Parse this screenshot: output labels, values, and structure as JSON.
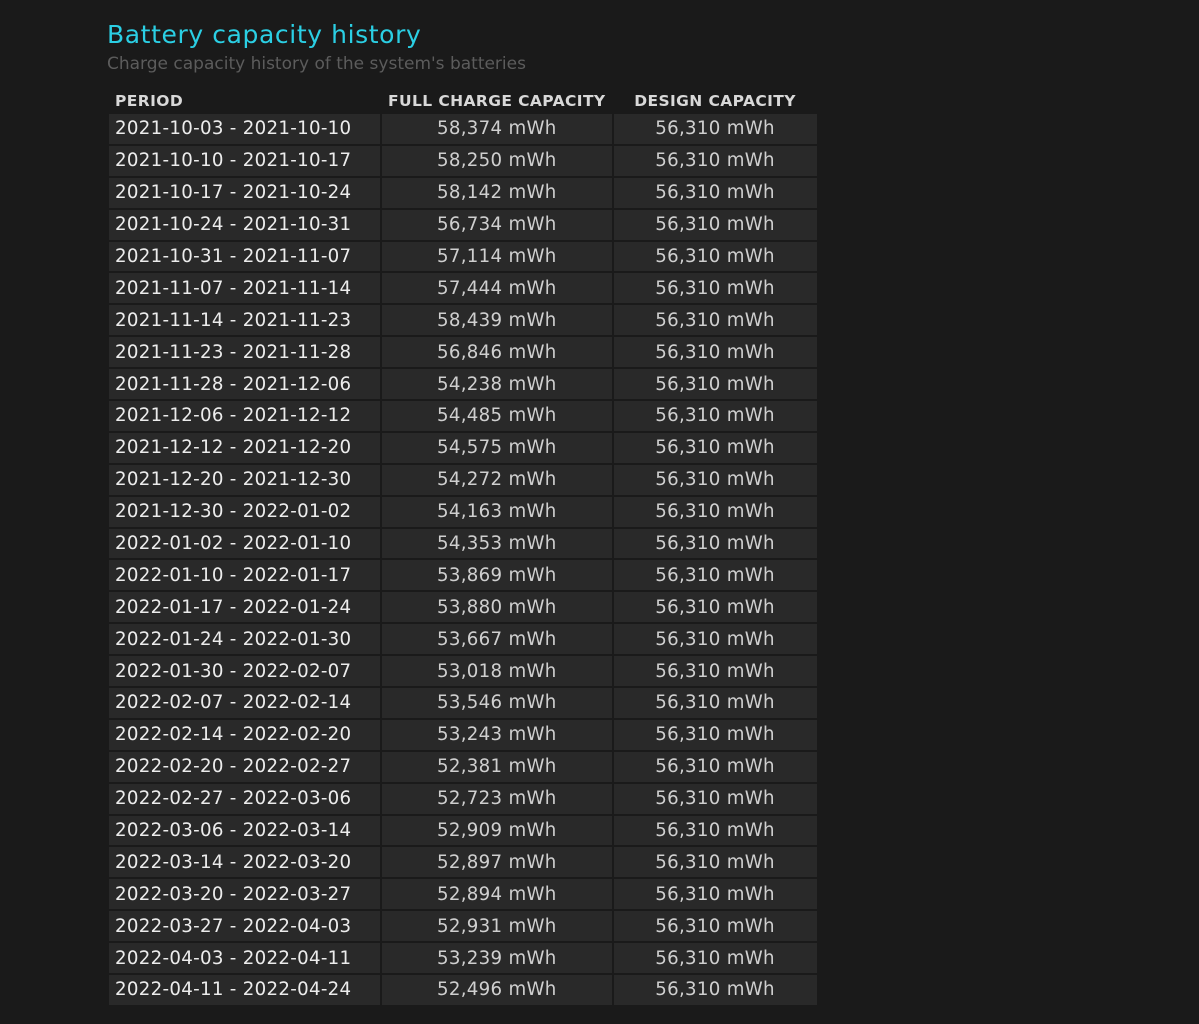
{
  "section": {
    "title": "Battery capacity history",
    "subtitle": "Charge capacity history of the system's batteries"
  },
  "table": {
    "headers": [
      "PERIOD",
      "FULL CHARGE CAPACITY",
      "DESIGN CAPACITY"
    ],
    "rows": [
      {
        "period": "2021-10-03 - 2021-10-10",
        "full": "58,374 mWh",
        "design": "56,310 mWh"
      },
      {
        "period": "2021-10-10 - 2021-10-17",
        "full": "58,250 mWh",
        "design": "56,310 mWh"
      },
      {
        "period": "2021-10-17 - 2021-10-24",
        "full": "58,142 mWh",
        "design": "56,310 mWh"
      },
      {
        "period": "2021-10-24 - 2021-10-31",
        "full": "56,734 mWh",
        "design": "56,310 mWh"
      },
      {
        "period": "2021-10-31 - 2021-11-07",
        "full": "57,114 mWh",
        "design": "56,310 mWh"
      },
      {
        "period": "2021-11-07 - 2021-11-14",
        "full": "57,444 mWh",
        "design": "56,310 mWh"
      },
      {
        "period": "2021-11-14 - 2021-11-23",
        "full": "58,439 mWh",
        "design": "56,310 mWh"
      },
      {
        "period": "2021-11-23 - 2021-11-28",
        "full": "56,846 mWh",
        "design": "56,310 mWh"
      },
      {
        "period": "2021-11-28 - 2021-12-06",
        "full": "54,238 mWh",
        "design": "56,310 mWh"
      },
      {
        "period": "2021-12-06 - 2021-12-12",
        "full": "54,485 mWh",
        "design": "56,310 mWh"
      },
      {
        "period": "2021-12-12 - 2021-12-20",
        "full": "54,575 mWh",
        "design": "56,310 mWh"
      },
      {
        "period": "2021-12-20 - 2021-12-30",
        "full": "54,272 mWh",
        "design": "56,310 mWh"
      },
      {
        "period": "2021-12-30 - 2022-01-02",
        "full": "54,163 mWh",
        "design": "56,310 mWh"
      },
      {
        "period": "2022-01-02 - 2022-01-10",
        "full": "54,353 mWh",
        "design": "56,310 mWh"
      },
      {
        "period": "2022-01-10 - 2022-01-17",
        "full": "53,869 mWh",
        "design": "56,310 mWh"
      },
      {
        "period": "2022-01-17 - 2022-01-24",
        "full": "53,880 mWh",
        "design": "56,310 mWh"
      },
      {
        "period": "2022-01-24 - 2022-01-30",
        "full": "53,667 mWh",
        "design": "56,310 mWh"
      },
      {
        "period": "2022-01-30 - 2022-02-07",
        "full": "53,018 mWh",
        "design": "56,310 mWh"
      },
      {
        "period": "2022-02-07 - 2022-02-14",
        "full": "53,546 mWh",
        "design": "56,310 mWh"
      },
      {
        "period": "2022-02-14 - 2022-02-20",
        "full": "53,243 mWh",
        "design": "56,310 mWh"
      },
      {
        "period": "2022-02-20 - 2022-02-27",
        "full": "52,381 mWh",
        "design": "56,310 mWh"
      },
      {
        "period": "2022-02-27 - 2022-03-06",
        "full": "52,723 mWh",
        "design": "56,310 mWh"
      },
      {
        "period": "2022-03-06 - 2022-03-14",
        "full": "52,909 mWh",
        "design": "56,310 mWh"
      },
      {
        "period": "2022-03-14 - 2022-03-20",
        "full": "52,897 mWh",
        "design": "56,310 mWh"
      },
      {
        "period": "2022-03-20 - 2022-03-27",
        "full": "52,894 mWh",
        "design": "56,310 mWh"
      },
      {
        "period": "2022-03-27 - 2022-04-03",
        "full": "52,931 mWh",
        "design": "56,310 mWh"
      },
      {
        "period": "2022-04-03 - 2022-04-11",
        "full": "53,239 mWh",
        "design": "56,310 mWh"
      },
      {
        "period": "2022-04-11 - 2022-04-24",
        "full": "52,496 mWh",
        "design": "56,310 mWh"
      }
    ]
  },
  "colors": {
    "background": "#1a1a1a",
    "title": "#2bcfe4",
    "subtitle": "#5c5c5c",
    "cell": "#292929"
  }
}
